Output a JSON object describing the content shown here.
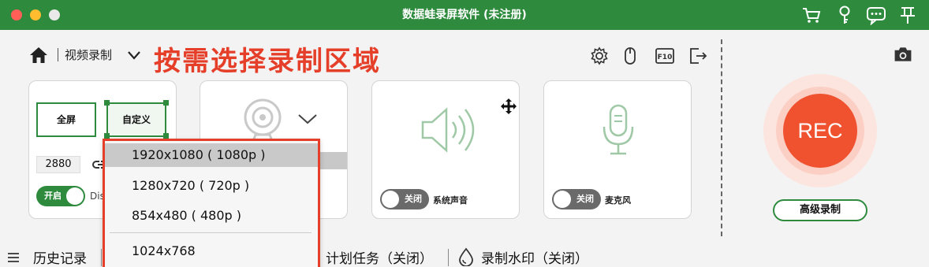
{
  "window": {
    "title": "数据蛙录屏软件 (未注册)",
    "accent": "#2e8b3e",
    "titlebar_icons": [
      "cart-icon",
      "key-icon",
      "chat-icon",
      "pin-icon"
    ]
  },
  "toolbar": {
    "mode_label": "视频录制",
    "annotation": "按需选择录制区域",
    "annotation_color": "#e53f2a",
    "tools": [
      "settings-icon",
      "mouse-icon",
      "fn-icon",
      "exit-icon"
    ]
  },
  "area_panel": {
    "full_label": "全屏",
    "custom_label": "自定义",
    "width_value": "2880",
    "toggle_label": "开启",
    "toggle_state": "on",
    "truncated_text": "Dis"
  },
  "resolution_dropdown": {
    "options": [
      "1920x1080 ( 1080p )",
      "1280x720 ( 720p )",
      "854x480 ( 480p )",
      "1024x768"
    ],
    "selected": "1920x1080 ( 1080p )"
  },
  "system_audio": {
    "toggle_label": "关闭",
    "label": "系统声音"
  },
  "microphone": {
    "toggle_label": "关闭",
    "label": "麦克风"
  },
  "rec": {
    "label": "REC",
    "color": "#f0522f"
  },
  "advanced_button": "高级录制",
  "bottom_bar": {
    "history": "历史记录",
    "schedule": "计划任务（关闭）",
    "watermark": "录制水印（关闭）"
  }
}
